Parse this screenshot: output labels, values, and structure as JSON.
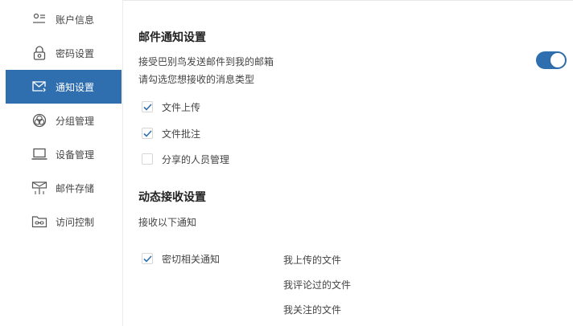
{
  "sidebar": {
    "items": [
      {
        "label": "账户信息",
        "icon": "account-list-icon",
        "active": false
      },
      {
        "label": "密码设置",
        "icon": "lock-icon",
        "active": false
      },
      {
        "label": "通知设置",
        "icon": "mail-notification-icon",
        "active": true
      },
      {
        "label": "分组管理",
        "icon": "group-circles-icon",
        "active": false
      },
      {
        "label": "设备管理",
        "icon": "laptop-icon",
        "active": false
      },
      {
        "label": "邮件存储",
        "icon": "mail-storage-icon",
        "active": false
      },
      {
        "label": "访问控制",
        "icon": "folder-link-icon",
        "active": false
      }
    ]
  },
  "email_section": {
    "title": "邮件通知设置",
    "receive_text": "接受巴别鸟发送邮件到我的邮箱",
    "toggle_on": true,
    "select_hint": "请勾选您想接收的消息类型",
    "options": [
      {
        "label": "文件上传",
        "checked": true
      },
      {
        "label": "文件批注",
        "checked": true
      },
      {
        "label": "分享的人员管理",
        "checked": false
      }
    ]
  },
  "dynamic_section": {
    "title": "动态接收设置",
    "hint": "接收以下通知",
    "related": {
      "label": "密切相关通知",
      "checked": true
    },
    "related_items": [
      "我上传的文件",
      "我评论过的文件",
      "我关注的文件"
    ]
  },
  "colors": {
    "accent": "#2f6fb0",
    "check": "#2f6fb0"
  }
}
